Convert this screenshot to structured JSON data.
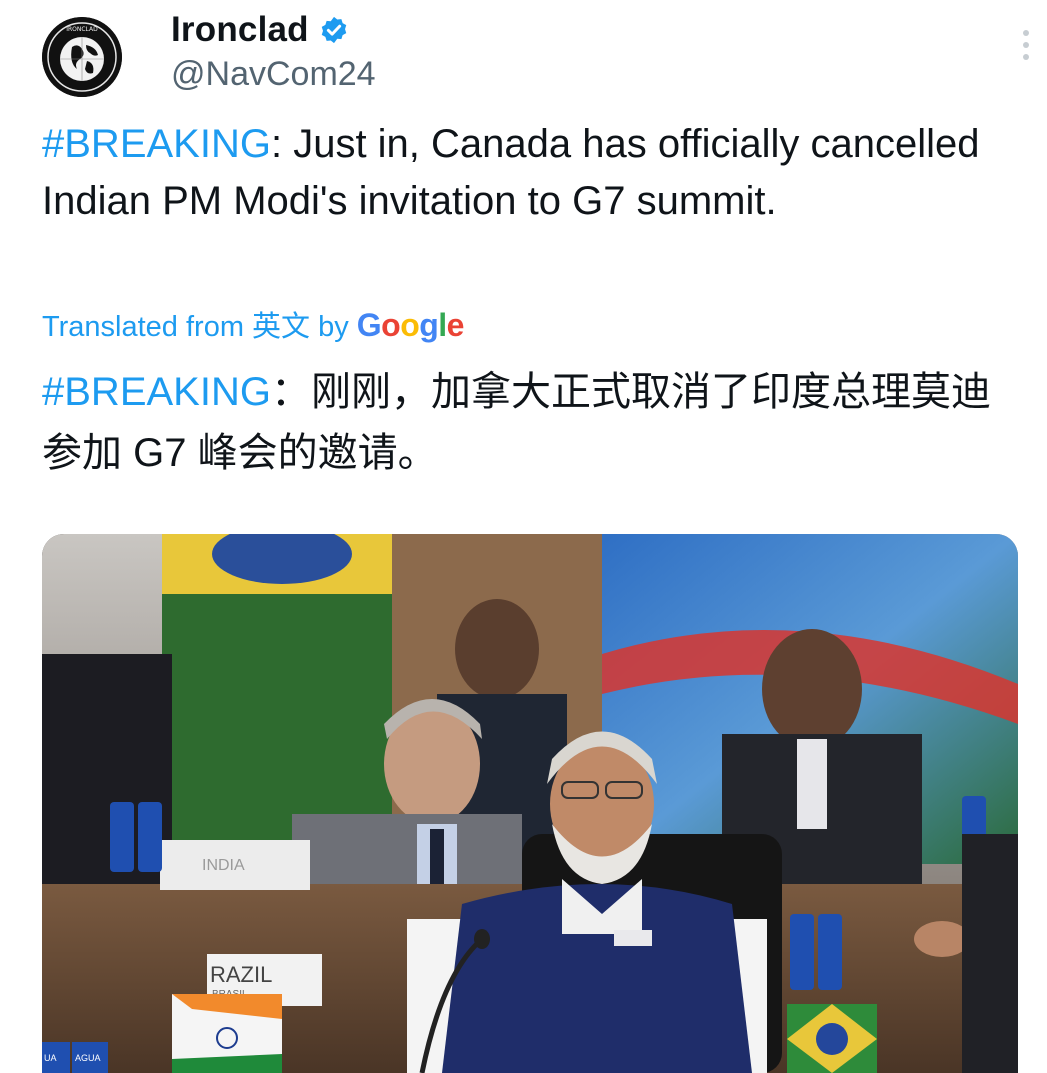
{
  "author": {
    "display_name": "Ironclad",
    "handle": "@NavCom24",
    "avatar_text": "IRONCLAD",
    "verified_icon": "verified-badge-icon",
    "verified_color": "#1d9bf0"
  },
  "tweet": {
    "hashtag": "#BREAKING",
    "text": ": Just in, Canada has officially cancelled Indian PM Modi's invitation to G7 summit."
  },
  "translation": {
    "label": "Translated from 英文 by",
    "provider": [
      "G",
      "o",
      "o",
      "g",
      "l",
      "e"
    ],
    "hashtag": "#BREAKING",
    "text": "：刚刚，加拿大正式取消了印度总理莫迪参加 G7 峰会的邀请。"
  },
  "media": {
    "placard_india": "INDIA",
    "placard_brazil": "RAZIL",
    "placard_brazil_sub": "BRASIL",
    "can_label": "AGUA",
    "can_label_left": "UA"
  },
  "colors": {
    "link": "#1d9bf0",
    "text": "#0f1419",
    "secondary": "#536471"
  }
}
